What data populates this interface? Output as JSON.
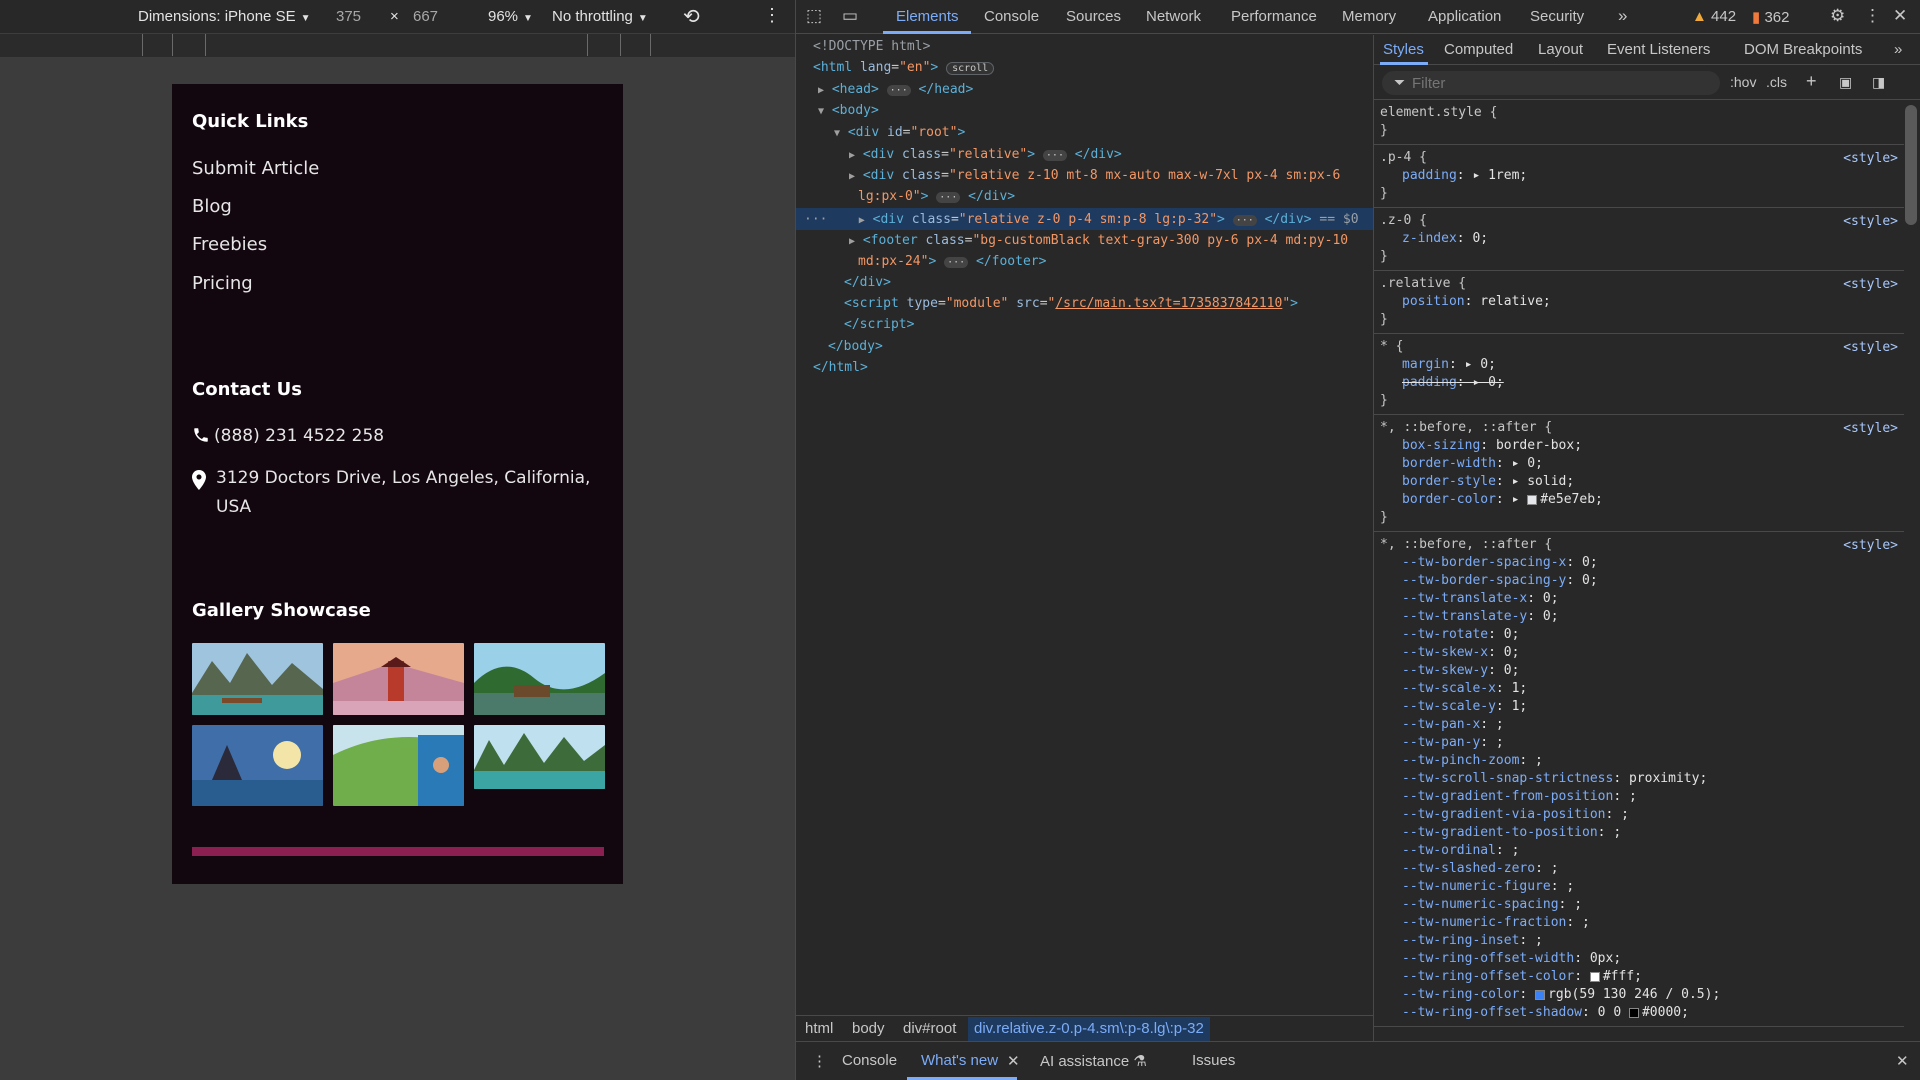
{
  "device_toolbar": {
    "dimensions_label": "Dimensions: iPhone SE",
    "width": "375",
    "times": "×",
    "height": "667",
    "zoom": "96%",
    "throttle": "No throttling"
  },
  "site": {
    "quick_links_title": "Quick Links",
    "quick_links": [
      "Submit Article",
      "Blog",
      "Freebies",
      "Pricing"
    ],
    "contact_title": "Contact Us",
    "phone": "(888) 231 4522 258",
    "address_line1": "3129 Doctors Drive, Los Angeles, California,",
    "address_line2": "USA",
    "gallery_title": "Gallery Showcase",
    "accent_color": "#8b1f52"
  },
  "devtools": {
    "tabs": [
      "Elements",
      "Console",
      "Sources",
      "Network",
      "Performance",
      "Memory",
      "Application",
      "Security"
    ],
    "warnings_count": "442",
    "issues_count": "362",
    "breadcrumb": [
      "html",
      "body",
      "div#root",
      "div.relative.z-0.p-4.sm\\:p-8.lg\\:p-32"
    ],
    "style_tabs": [
      "Styles",
      "Computed",
      "Layout",
      "Event Listeners",
      "DOM Breakpoints"
    ],
    "filter_placeholder": "Filter",
    "hov": ":hov",
    "cls": ".cls",
    "drawer_tabs": [
      "Console",
      "What's new",
      "AI assistance",
      "Issues"
    ],
    "tree": {
      "doctype": "<!DOCTYPE html>",
      "script_src": "/src/main.tsx?t=1735837842110",
      "sel_suffix": "== $0"
    },
    "source_label": "<style>"
  }
}
